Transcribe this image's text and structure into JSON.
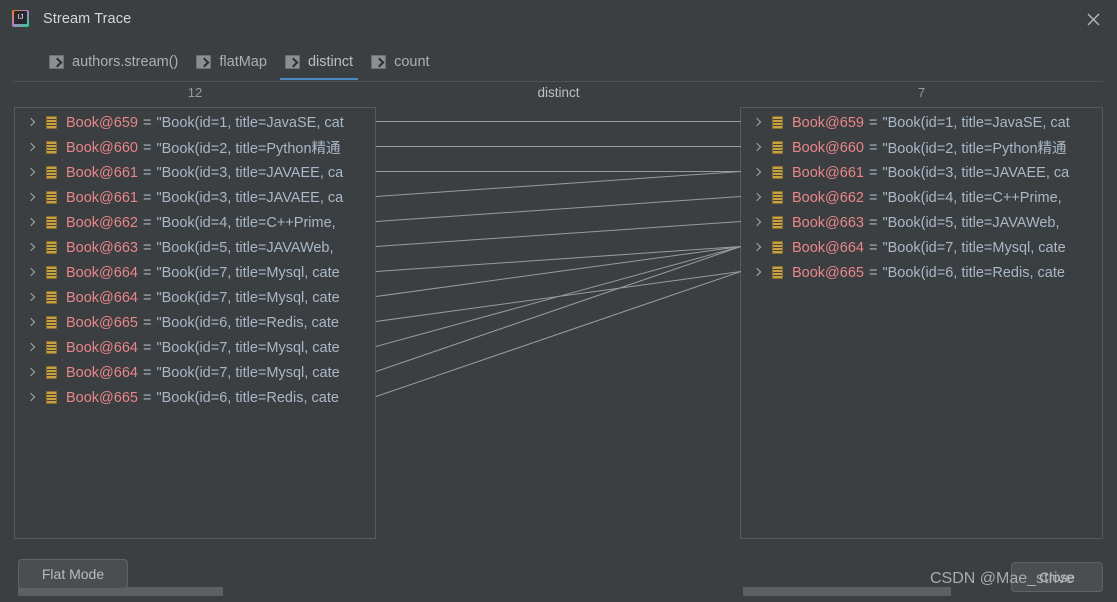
{
  "window": {
    "title": "Stream Trace",
    "app_icon": "intellij-idea-icon",
    "close_icon": "close-icon"
  },
  "tabs": [
    {
      "label": "authors.stream()",
      "icon": "stream-step-icon",
      "active": false
    },
    {
      "label": "flatMap",
      "icon": "stream-step-icon",
      "active": false
    },
    {
      "label": "distinct",
      "icon": "stream-step-icon",
      "active": true
    },
    {
      "label": "count",
      "icon": "stream-step-icon",
      "active": false
    }
  ],
  "trace": {
    "operation": "distinct",
    "left_count": "12",
    "right_count": "7",
    "left_items": [
      {
        "ref": "Book@659",
        "eq": "=",
        "value": "\"Book(id=1, title=JavaSE, cat"
      },
      {
        "ref": "Book@660",
        "eq": "=",
        "value": "\"Book(id=2, title=Python精通"
      },
      {
        "ref": "Book@661",
        "eq": "=",
        "value": "\"Book(id=3, title=JAVAEE, ca"
      },
      {
        "ref": "Book@661",
        "eq": "=",
        "value": "\"Book(id=3, title=JAVAEE, ca"
      },
      {
        "ref": "Book@662",
        "eq": "=",
        "value": "\"Book(id=4, title=C++Prime,"
      },
      {
        "ref": "Book@663",
        "eq": "=",
        "value": "\"Book(id=5, title=JAVAWeb,"
      },
      {
        "ref": "Book@664",
        "eq": "=",
        "value": "\"Book(id=7, title=Mysql, cate"
      },
      {
        "ref": "Book@664",
        "eq": "=",
        "value": "\"Book(id=7, title=Mysql, cate"
      },
      {
        "ref": "Book@665",
        "eq": "=",
        "value": "\"Book(id=6, title=Redis, cate"
      },
      {
        "ref": "Book@664",
        "eq": "=",
        "value": "\"Book(id=7, title=Mysql, cate"
      },
      {
        "ref": "Book@664",
        "eq": "=",
        "value": "\"Book(id=7, title=Mysql, cate"
      },
      {
        "ref": "Book@665",
        "eq": "=",
        "value": "\"Book(id=6, title=Redis, cate"
      }
    ],
    "right_items": [
      {
        "ref": "Book@659",
        "eq": "=",
        "value": "\"Book(id=1, title=JavaSE, cat"
      },
      {
        "ref": "Book@660",
        "eq": "=",
        "value": "\"Book(id=2, title=Python精通"
      },
      {
        "ref": "Book@661",
        "eq": "=",
        "value": "\"Book(id=3, title=JAVAEE, ca"
      },
      {
        "ref": "Book@662",
        "eq": "=",
        "value": "\"Book(id=4, title=C++Prime,"
      },
      {
        "ref": "Book@663",
        "eq": "=",
        "value": "\"Book(id=5, title=JAVAWeb,"
      },
      {
        "ref": "Book@664",
        "eq": "=",
        "value": "\"Book(id=7, title=Mysql, cate"
      },
      {
        "ref": "Book@665",
        "eq": "=",
        "value": "\"Book(id=6, title=Redis, cate"
      }
    ],
    "links": [
      [
        0,
        0
      ],
      [
        1,
        1
      ],
      [
        2,
        2
      ],
      [
        3,
        2
      ],
      [
        4,
        3
      ],
      [
        5,
        4
      ],
      [
        6,
        5
      ],
      [
        7,
        5
      ],
      [
        8,
        6
      ],
      [
        9,
        5
      ],
      [
        10,
        5
      ],
      [
        11,
        6
      ]
    ],
    "item_icon": "object-instance-icon",
    "expand_icon": "chevron-right-icon"
  },
  "buttons": {
    "flat_mode": "Flat Mode",
    "close": "Close"
  },
  "watermark": "CSDN @Mae_strive",
  "colors": {
    "background": "#3c3f41",
    "reference": "#e8868a",
    "value": "#a9b7c6",
    "accent": "#4a88c7",
    "icon_gold": "#c8a141",
    "link_line": "#9a9a9a"
  }
}
